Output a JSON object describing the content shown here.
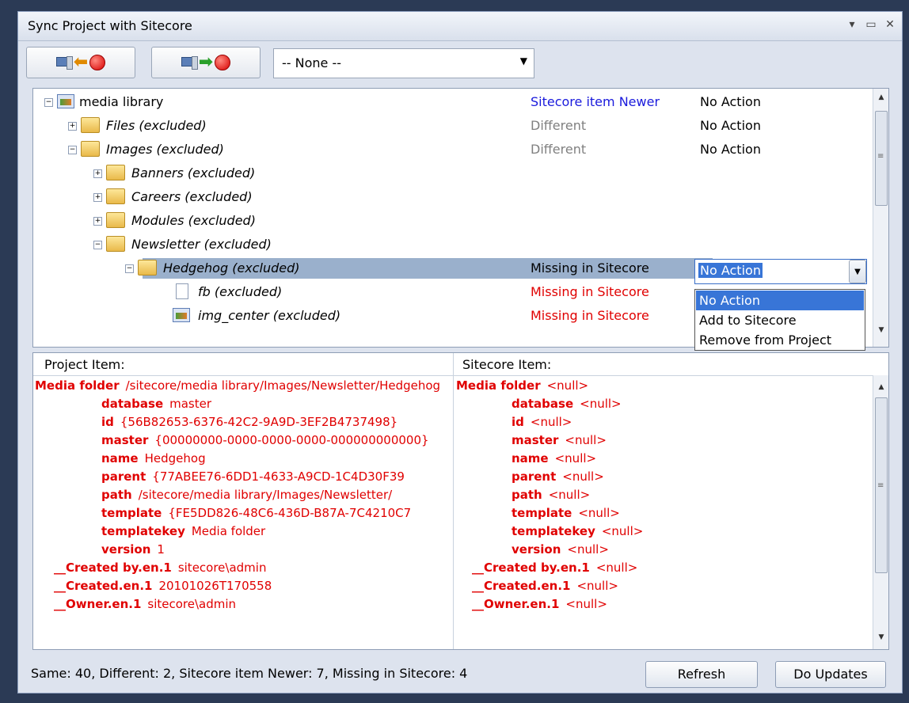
{
  "window": {
    "title": "Sync Project with Sitecore"
  },
  "toolbar": {
    "combo_value": "-- None --"
  },
  "tree": {
    "rows": [
      {
        "name": "media library",
        "status": "Sitecore item Newer",
        "status_color": "#1a1adc",
        "action": "No Action"
      },
      {
        "name": "Files (excluded)",
        "status": "Different",
        "status_color": "#808080",
        "action": "No Action"
      },
      {
        "name": "Images (excluded)",
        "status": "Different",
        "status_color": "#808080",
        "action": "No Action"
      },
      {
        "name": "Banners (excluded)",
        "status": "",
        "action": ""
      },
      {
        "name": "Careers (excluded)",
        "status": "",
        "action": ""
      },
      {
        "name": "Modules (excluded)",
        "status": "",
        "action": ""
      },
      {
        "name": "Newsletter (excluded)",
        "status": "",
        "action": ""
      },
      {
        "name": "Hedgehog (excluded)",
        "status": "Missing in Sitecore",
        "status_color": "#000000",
        "action": ""
      },
      {
        "name": "fb (excluded)",
        "status": "Missing in Sitecore",
        "status_color": "#e00000",
        "action": ""
      },
      {
        "name": "img_center (excluded)",
        "status": "Missing in Sitecore",
        "status_color": "#e00000",
        "action": ""
      }
    ],
    "selected_action": "No Action",
    "options": [
      "No Action",
      "Add to Sitecore",
      "Remove from Project"
    ]
  },
  "grid": {
    "project_header": "Project Item:",
    "sitecore_header": "Sitecore Item:",
    "rows": [
      {
        "key": "Media folder",
        "project": "/sitecore/media library/Images/Newsletter/Hedgehog",
        "sitecore": "<null>"
      },
      {
        "key": "database",
        "project": "master",
        "sitecore": "<null>"
      },
      {
        "key": "id",
        "project": "{56B82653-6376-42C2-9A9D-3EF2B4737498}",
        "sitecore": "<null>"
      },
      {
        "key": "master",
        "project": "{00000000-0000-0000-0000-000000000000}",
        "sitecore": "<null>"
      },
      {
        "key": "name",
        "project": "Hedgehog",
        "sitecore": "<null>"
      },
      {
        "key": "parent",
        "project": "{77ABEE76-6DD1-4633-A9CD-1C4D30F39",
        "sitecore": "<null>"
      },
      {
        "key": "path",
        "project": "/sitecore/media library/Images/Newsletter/",
        "sitecore": "<null>"
      },
      {
        "key": "template",
        "project": "{FE5DD826-48C6-436D-B87A-7C4210C7",
        "sitecore": "<null>"
      },
      {
        "key": "templatekey",
        "project": "Media folder",
        "sitecore": "<null>"
      },
      {
        "key": "version",
        "project": "1",
        "sitecore": "<null>"
      },
      {
        "key": "__Created by.en.1",
        "project": "sitecore\\admin",
        "sitecore": "<null>"
      },
      {
        "key": "__Created.en.1",
        "project": "20101026T170558",
        "sitecore": "<null>"
      },
      {
        "key": "__Owner.en.1",
        "project": "sitecore\\admin",
        "sitecore": "<null>"
      }
    ]
  },
  "footer": {
    "summary": "Same: 40, Different: 2, Sitecore item Newer: 7, Missing in Sitecore: 4",
    "refresh_label": "Refresh",
    "update_label": "Do Updates"
  }
}
